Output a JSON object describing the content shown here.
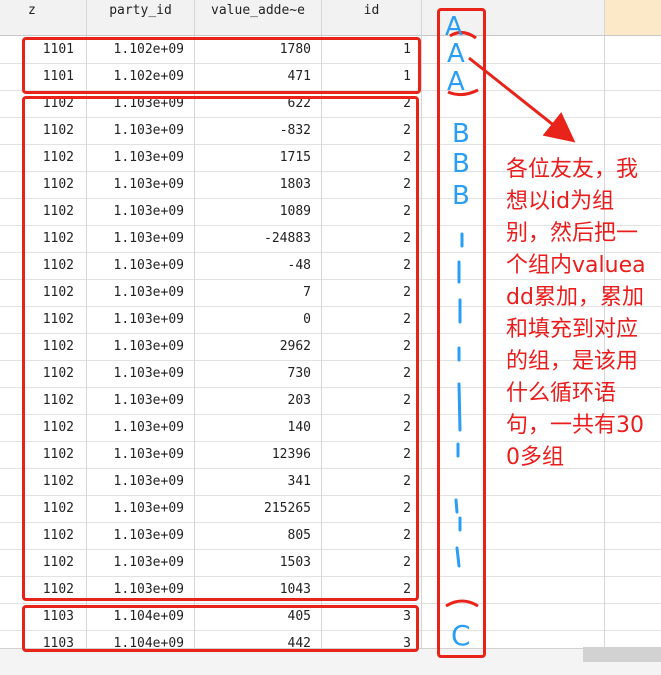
{
  "table": {
    "columns": [
      "z",
      "party_id",
      "value_adde~e",
      "id",
      "",
      ""
    ],
    "rows": [
      {
        "z": "1101",
        "party_id": "1.102e+09",
        "value": "1780",
        "id": "1"
      },
      {
        "z": "1101",
        "party_id": "1.102e+09",
        "value": "471",
        "id": "1"
      },
      {
        "z": "1102",
        "party_id": "1.103e+09",
        "value": "622",
        "id": "2"
      },
      {
        "z": "1102",
        "party_id": "1.103e+09",
        "value": "-832",
        "id": "2"
      },
      {
        "z": "1102",
        "party_id": "1.103e+09",
        "value": "1715",
        "id": "2"
      },
      {
        "z": "1102",
        "party_id": "1.103e+09",
        "value": "1803",
        "id": "2"
      },
      {
        "z": "1102",
        "party_id": "1.103e+09",
        "value": "1089",
        "id": "2"
      },
      {
        "z": "1102",
        "party_id": "1.103e+09",
        "value": "-24883",
        "id": "2"
      },
      {
        "z": "1102",
        "party_id": "1.103e+09",
        "value": "-48",
        "id": "2"
      },
      {
        "z": "1102",
        "party_id": "1.103e+09",
        "value": "7",
        "id": "2"
      },
      {
        "z": "1102",
        "party_id": "1.103e+09",
        "value": "0",
        "id": "2"
      },
      {
        "z": "1102",
        "party_id": "1.103e+09",
        "value": "2962",
        "id": "2"
      },
      {
        "z": "1102",
        "party_id": "1.103e+09",
        "value": "730",
        "id": "2"
      },
      {
        "z": "1102",
        "party_id": "1.103e+09",
        "value": "203",
        "id": "2"
      },
      {
        "z": "1102",
        "party_id": "1.103e+09",
        "value": "140",
        "id": "2"
      },
      {
        "z": "1102",
        "party_id": "1.103e+09",
        "value": "12396",
        "id": "2"
      },
      {
        "z": "1102",
        "party_id": "1.103e+09",
        "value": "341",
        "id": "2"
      },
      {
        "z": "1102",
        "party_id": "1.103e+09",
        "value": "215265",
        "id": "2"
      },
      {
        "z": "1102",
        "party_id": "1.103e+09",
        "value": "805",
        "id": "2"
      },
      {
        "z": "1102",
        "party_id": "1.103e+09",
        "value": "1503",
        "id": "2"
      },
      {
        "z": "1102",
        "party_id": "1.103e+09",
        "value": "1043",
        "id": "2"
      },
      {
        "z": "1103",
        "party_id": "1.104e+09",
        "value": "405",
        "id": "3"
      },
      {
        "z": "1103",
        "party_id": "1.104e+09",
        "value": "442",
        "id": "3"
      }
    ]
  },
  "annotation": {
    "note_lines": [
      "各位友友，",
      "我想以id为",
      "组别，然后",
      "把一个组内",
      "valueadd",
      "累加，累加",
      "和填充到对",
      "应的组，是",
      "该用什么循",
      "环语句，一",
      "共有300多",
      "组"
    ],
    "handwritten_letters": [
      "A",
      "A",
      "A",
      "B",
      "B",
      "B",
      "C"
    ],
    "ink_red": "#e8231a",
    "ink_blue": "#2a9df4"
  },
  "colors": {
    "header_bg": "#f2f2f2",
    "header_highlight": "#fbe9c8",
    "grid_line": "#e2e2e2"
  }
}
